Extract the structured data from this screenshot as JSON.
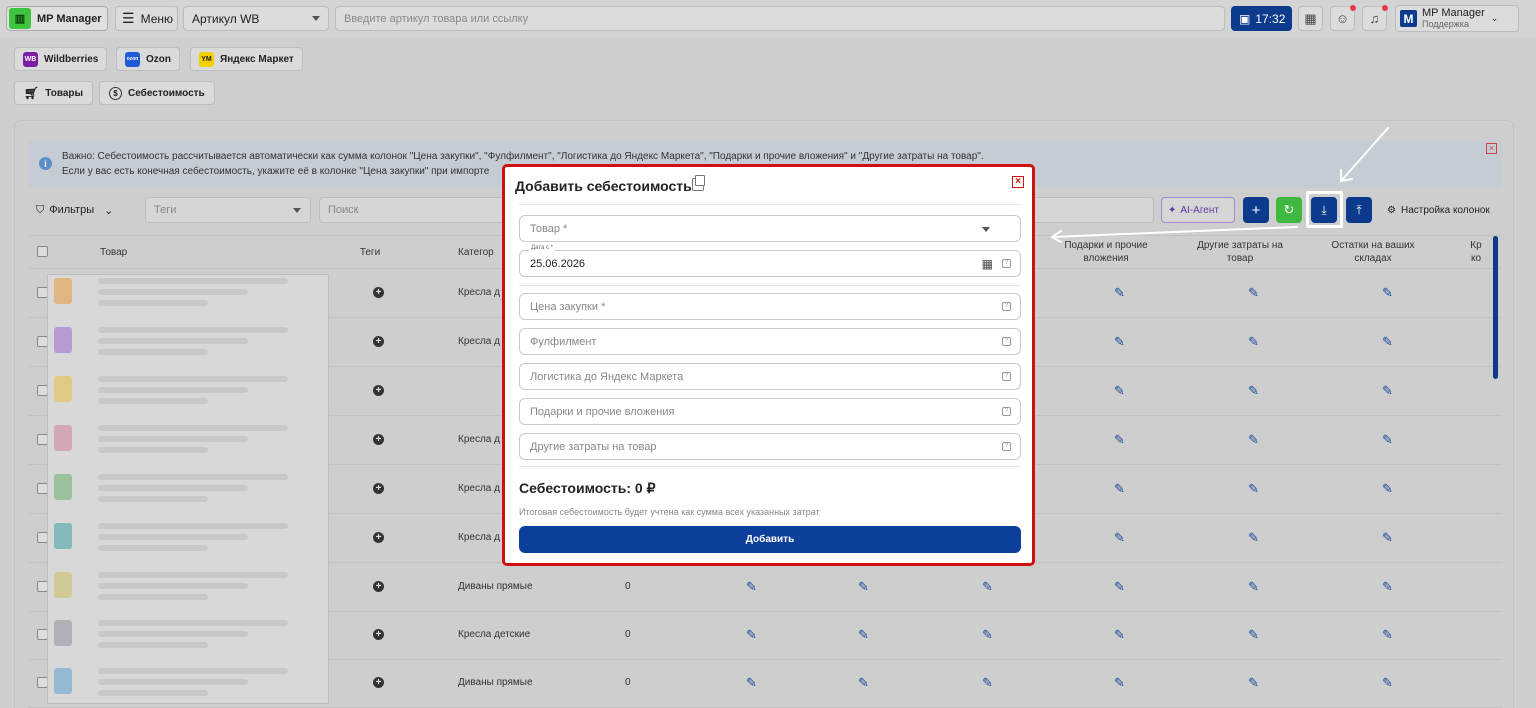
{
  "topbar": {
    "logo_text": "MP Manager",
    "menu_label": "Меню",
    "article_select": "Артикул WB",
    "search_placeholder": "Введите артикул товара или ссылку",
    "time": "17:32",
    "account_name": "MP Manager",
    "account_sub": "Поддержка"
  },
  "marketplaces": [
    {
      "label": "Wildberries",
      "logo": "WB",
      "color": "#7b1fa2"
    },
    {
      "label": "Ozon",
      "logo": "ozon",
      "color": "#1e5bd6"
    },
    {
      "label": "Яндекс Маркет",
      "logo": "YM",
      "color": "#f5d000"
    }
  ],
  "tabs": [
    {
      "label": "Товары",
      "icon": "cart-icon"
    },
    {
      "label": "Себестоимость",
      "icon": "dollar-circle-icon"
    }
  ],
  "notice": {
    "line1": "Важно: Себестоимость рассчитывается автоматически как сумма колонок \"Цена закупки\", \"Фулфилмент\", \"Логистика до Яндекс Маркета\", \"Подарки и прочие вложения\" и \"Другие затраты на товар\".",
    "line2": "Если у вас есть конечная себестоимость, укажите её в колонке \"Цена закупки\" при импорте"
  },
  "toolbar": {
    "filters_label": "Фильтры",
    "tags_placeholder": "Теги",
    "search_placeholder": "Поиск",
    "ai_agent_label": "AI-Агент",
    "columns_label": "Настройка колонок"
  },
  "table": {
    "headers": {
      "product": "Товар",
      "tags": "Теги",
      "category": "Категор",
      "gifts": "Подарки и прочие вложения",
      "other": "Другие затраты на товар",
      "stock": "Остатки на ваших складах",
      "last": "Кр ко"
    },
    "rows": [
      {
        "category": "Кресла д",
        "value": ""
      },
      {
        "category": "Кресла д",
        "value": ""
      },
      {
        "category": "",
        "value": ""
      },
      {
        "category": "Кресла д",
        "value": ""
      },
      {
        "category": "Кресла д",
        "value": ""
      },
      {
        "category": "Кресла д",
        "value": ""
      },
      {
        "category": "Диваны прямые",
        "value": "0"
      },
      {
        "category": "Кресла детские",
        "value": "0"
      },
      {
        "category": "Диваны прямые",
        "value": "0"
      }
    ]
  },
  "modal": {
    "title": "Добавить себестоимость",
    "product_placeholder": "Товар *",
    "date_label": "Дата с *",
    "date_value": "25.06.2026",
    "purchase_placeholder": "Цена закупки *",
    "fulfillment_placeholder": "Фулфилмент",
    "logistics_placeholder": "Логистика до Яндекс Маркета",
    "gifts_placeholder": "Подарки и прочие вложения",
    "other_placeholder": "Другие затраты на товар",
    "total": "Себестоимость: 0 ₽",
    "hint": "Итоговая себестоимость будет учтена как сумма всех указанных затрат",
    "submit_label": "Добавить"
  }
}
